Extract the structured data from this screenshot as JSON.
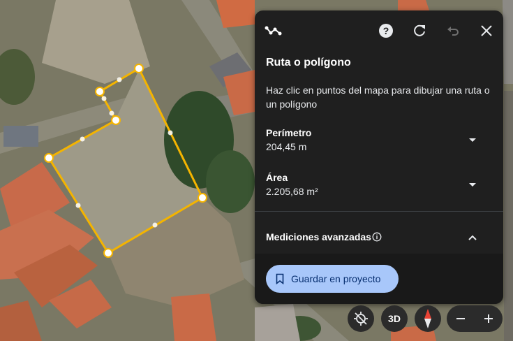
{
  "panel": {
    "title": "Ruta o polígono",
    "description": "Haz clic en puntos del mapa para dibujar una ruta o un polígono",
    "perimeter": {
      "label": "Perímetro",
      "value": "204,45 m"
    },
    "area": {
      "label": "Área",
      "value": "2.205,68 m²"
    },
    "advanced": {
      "label": "Mediciones avanzadas"
    },
    "save_label": "Guardar en proyecto",
    "toolbar_icons": [
      "measure-icon",
      "help-icon",
      "refresh-icon",
      "undo-icon",
      "close-icon"
    ]
  },
  "map_controls": {
    "threed_label": "3D",
    "icons": [
      "location-off-icon",
      "compass-icon",
      "zoom-out-icon",
      "zoom-in-icon"
    ]
  },
  "colors": {
    "accent_button": "#a8c7fa",
    "polygon_line": "#f4b400",
    "panel_bg": "#1f1f1f"
  }
}
